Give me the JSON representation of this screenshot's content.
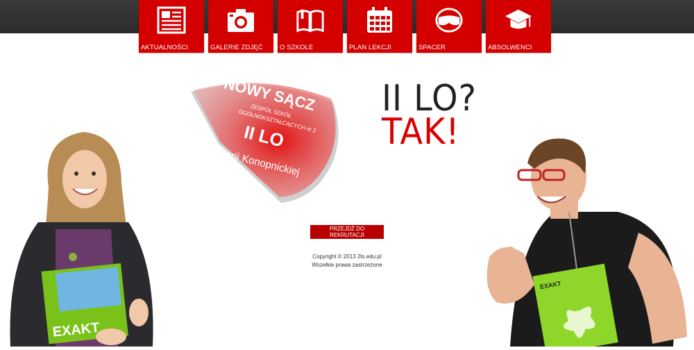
{
  "nav": {
    "items": [
      {
        "label": "AKTUALNOŚCI",
        "icon": "newspaper-icon"
      },
      {
        "label": "GALERIE ZDJĘĆ",
        "icon": "camera-icon"
      },
      {
        "label": "O SZKOLE",
        "icon": "book-icon"
      },
      {
        "label": "PLAN LEKCJI",
        "icon": "calendar-icon"
      },
      {
        "label": "SPACER",
        "icon": "vr-goggles-icon"
      },
      {
        "label": "ABSOLWENCI",
        "icon": "graduation-cap-icon"
      }
    ]
  },
  "colors": {
    "accent": "#d40000",
    "topbar": "#2f2f2f",
    "text": "#222222"
  },
  "badge": {
    "city": "NOWY SĄCZ",
    "line1": "ZESPÓŁ SZKÓŁ",
    "line2": "OGÓLNOKSZTAŁCĄCYCH nr 2",
    "school": "II LO",
    "patron": "im. Marii Konopnickiej"
  },
  "headline": {
    "line1": "II LO?",
    "line2": "TAK!"
  },
  "cta": {
    "label": "PRZEJDŹ DO REKRUTACJI"
  },
  "footer": {
    "copyright": "Copyright © 2013 2lo.edu.pl",
    "rights": "Wszelkie prawa zastrzeżone"
  },
  "books": {
    "left_title": "EXAKT",
    "right_title": "EXAKT"
  }
}
